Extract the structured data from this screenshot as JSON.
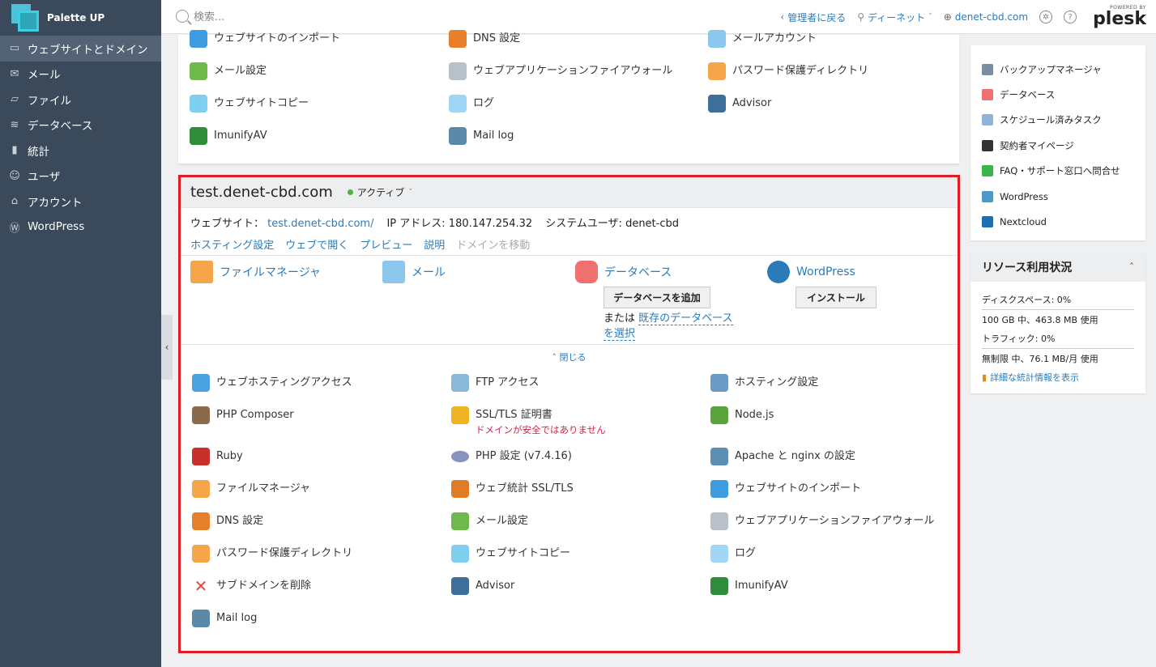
{
  "brand": {
    "name": "Palette UP"
  },
  "sidebar": {
    "items": [
      {
        "label": "ウェブサイトとドメイン",
        "icon": "monitor-icon",
        "active": true
      },
      {
        "label": "メール",
        "icon": "mail-icon"
      },
      {
        "label": "ファイル",
        "icon": "folder-icon"
      },
      {
        "label": "データベース",
        "icon": "layers-icon"
      },
      {
        "label": "統計",
        "icon": "bar-chart-icon"
      },
      {
        "label": "ユーザ",
        "icon": "user-icon"
      },
      {
        "label": "アカウント",
        "icon": "account-icon"
      },
      {
        "label": "WordPress",
        "icon": "wordpress-icon"
      }
    ]
  },
  "header": {
    "search_placeholder": "検索...",
    "back_admin": "管理者に戻る",
    "user": "ディーネット",
    "domain": "denet-cbd.com",
    "powered_by": "POWERED BY",
    "plesk": "plesk"
  },
  "prev_card": {
    "tools": [
      {
        "label": "ウェブサイトのインポート",
        "icon": "globe-import-icon"
      },
      {
        "label": "DNS 設定",
        "icon": "dns-flag-icon"
      },
      {
        "label": "メールアカウント",
        "icon": "envelope-icon"
      },
      {
        "label": "メール設定",
        "icon": "mail-settings-icon"
      },
      {
        "label": "ウェブアプリケーションファイアウォール",
        "icon": "shield-icon"
      },
      {
        "label": "パスワード保護ディレクトリ",
        "icon": "locked-folder-icon"
      },
      {
        "label": "ウェブサイトコピー",
        "icon": "copy-icon"
      },
      {
        "label": "ログ",
        "icon": "log-icon"
      },
      {
        "label": "Advisor",
        "icon": "owl-icon"
      },
      {
        "label": "ImunifyAV",
        "icon": "gear-green-icon"
      },
      {
        "label": "Mail log",
        "icon": "mail-log-icon"
      }
    ]
  },
  "domain": {
    "name": "test.denet-cbd.com",
    "status": "アクティブ",
    "website_label": "ウェブサイト：",
    "website_url": "test.denet-cbd.com/",
    "ip_label": "IP アドレス:",
    "ip": "180.147.254.32",
    "sysuser_label": "システムユーザ:",
    "sysuser": "denet-cbd",
    "actions": [
      "ホスティング設定",
      "ウェブで開く",
      "プレビュー",
      "説明"
    ],
    "move_domain": "ドメインを移動",
    "quick": {
      "file_manager": "ファイルマネージャ",
      "mail": "メール",
      "database": "データベース",
      "add_database": "データベースを追加",
      "or": "または",
      "select_existing": "既存のデータベース",
      "select_existing_2": "を選択",
      "wordpress": "WordPress",
      "install": "インストール"
    },
    "collapse": "閉じる",
    "tools": [
      {
        "label": "ウェブホスティングアクセス",
        "icon": "globe-access-icon"
      },
      {
        "label": "FTP アクセス",
        "icon": "ftp-icon"
      },
      {
        "label": "ホスティング設定",
        "icon": "hosting-settings-icon"
      },
      {
        "label": "PHP Composer",
        "icon": "composer-icon"
      },
      {
        "label": "SSL/TLS 証明書",
        "icon": "lock-icon",
        "warning": "ドメインが安全ではありません"
      },
      {
        "label": "Node.js",
        "icon": "nodejs-icon"
      },
      {
        "label": "Ruby",
        "icon": "ruby-icon"
      },
      {
        "label": "PHP 設定 (v7.4.16)",
        "icon": "php-icon"
      },
      {
        "label": "Apache と nginx の設定",
        "icon": "apache-nginx-icon"
      },
      {
        "label": "ファイルマネージャ",
        "icon": "folder-icon"
      },
      {
        "label": "ウェブ統計 SSL/TLS",
        "icon": "web-stats-icon"
      },
      {
        "label": "ウェブサイトのインポート",
        "icon": "globe-import-icon"
      },
      {
        "label": "DNS 設定",
        "icon": "dns-flag-icon"
      },
      {
        "label": "メール設定",
        "icon": "mail-settings-icon"
      },
      {
        "label": "ウェブアプリケーションファイアウォール",
        "icon": "shield-icon"
      },
      {
        "label": "パスワード保護ディレクトリ",
        "icon": "locked-folder-icon"
      },
      {
        "label": "ウェブサイトコピー",
        "icon": "copy-icon"
      },
      {
        "label": "ログ",
        "icon": "log-icon"
      },
      {
        "label": "サブドメインを削除",
        "icon": "delete-x-icon"
      },
      {
        "label": "Advisor",
        "icon": "owl-icon"
      },
      {
        "label": "ImunifyAV",
        "icon": "gear-green-icon"
      },
      {
        "label": "Mail log",
        "icon": "mail-log-icon"
      }
    ]
  },
  "right_panel": {
    "links": [
      {
        "label": "バックアップマネージャ",
        "icon": "backup-icon",
        "color": "#7a8ea3"
      },
      {
        "label": "データベース",
        "icon": "database-icon",
        "color": "#f07070"
      },
      {
        "label": "スケジュール済みタスク",
        "icon": "calendar-icon",
        "color": "#8fb4d9"
      },
      {
        "label": "契約者マイページ",
        "icon": "a-logo-icon",
        "color": "#333333"
      },
      {
        "label": "FAQ・サポート窓口へ問合せ",
        "icon": "support-icon",
        "color": "#3bb54a"
      },
      {
        "label": "WordPress",
        "icon": "wordpress-icon",
        "color": "#4a9ac9"
      },
      {
        "label": "Nextcloud",
        "icon": "nextcloud-icon",
        "color": "#1b6fb3"
      }
    ],
    "resources": {
      "title": "リソース利用状況",
      "disk_label": "ディスクスペース: 0%",
      "disk_detail": "100 GB 中、463.8 MB 使用",
      "traffic_label": "トラフィック: 0%",
      "traffic_detail": "無制限 中、76.1 MB/月 使用",
      "stats_link": "詳細な統計情報を表示"
    }
  },
  "colors": {
    "sidebar_bg": "#3b4a5a",
    "highlight_border": "#e01d23",
    "link": "#2b7bb9",
    "warning": "#d0244a"
  }
}
